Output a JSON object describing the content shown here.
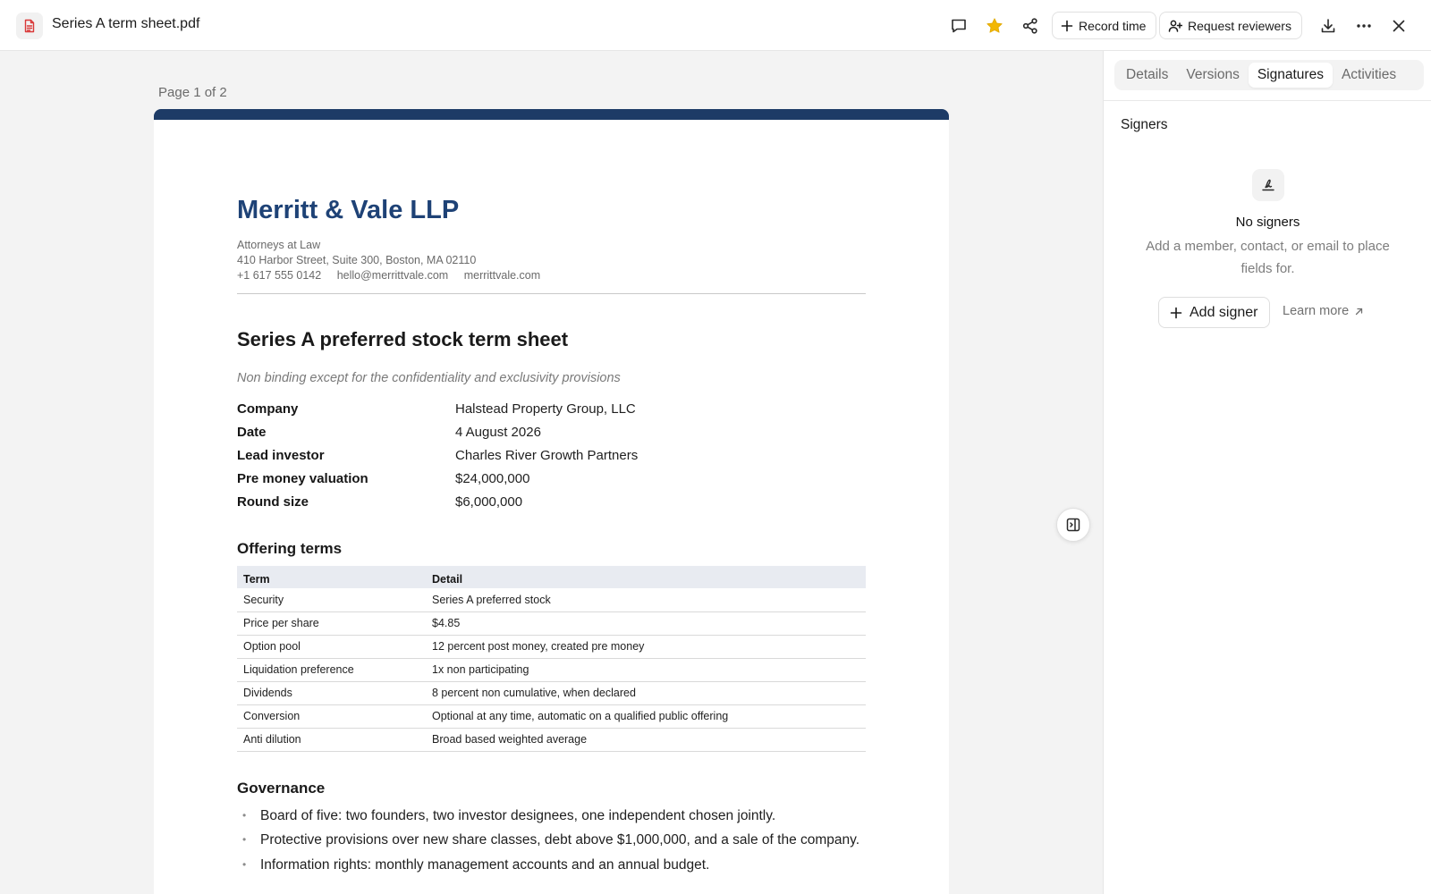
{
  "header": {
    "file_name": "Series A term sheet.pdf",
    "record_time_label": "Record time",
    "request_reviewers_label": "Request reviewers",
    "favorite_color": "#f2b705",
    "file_icon_color": "#d93838"
  },
  "document": {
    "page_indicator": "Page 1 of 2",
    "accent_color": "#1d3b66",
    "firm": {
      "name": "Merritt & Vale LLP",
      "tagline": "Attorneys at Law",
      "address": "410 Harbor Street, Suite 300, Boston, MA 02110",
      "phone": "+1 617 555 0142",
      "email": "hello@merrittvale.com",
      "website": "merrittvale.com"
    },
    "title": "Series A preferred stock term sheet",
    "subtitle": "Non binding except for the confidentiality and exclusivity provisions",
    "summary": [
      {
        "key": "Company",
        "value": "Halstead Property Group, LLC"
      },
      {
        "key": "Date",
        "value": "4 August 2026"
      },
      {
        "key": "Lead investor",
        "value": "Charles River Growth Partners"
      },
      {
        "key": "Pre money valuation",
        "value": "$24,000,000"
      },
      {
        "key": "Round size",
        "value": "$6,000,000"
      }
    ],
    "offering": {
      "heading": "Offering terms",
      "columns": [
        "Term",
        "Detail"
      ],
      "rows": [
        [
          "Security",
          "Series A preferred stock"
        ],
        [
          "Price per share",
          "$4.85"
        ],
        [
          "Option pool",
          "12 percent post money, created pre money"
        ],
        [
          "Liquidation preference",
          "1x non participating"
        ],
        [
          "Dividends",
          "8 percent non cumulative, when declared"
        ],
        [
          "Conversion",
          "Optional at any time, automatic on a qualified public offering"
        ],
        [
          "Anti dilution",
          "Broad based weighted average"
        ]
      ]
    },
    "governance": {
      "heading": "Governance",
      "items": [
        "Board of five: two founders, two investor designees, one independent chosen jointly.",
        "Protective provisions over new share classes, debt above $1,000,000, and a sale of the company.",
        "Information rights: monthly management accounts and an annual budget."
      ]
    }
  },
  "panel": {
    "tabs": [
      {
        "label": "Details"
      },
      {
        "label": "Versions"
      },
      {
        "label": "Signatures"
      },
      {
        "label": "Activities"
      }
    ],
    "active_tab": "Signatures",
    "signers_heading": "Signers",
    "empty_title": "No signers",
    "empty_description": "Add a member, contact, or email to place fields for.",
    "add_signer_label": "Add signer",
    "learn_more_label": "Learn more"
  }
}
